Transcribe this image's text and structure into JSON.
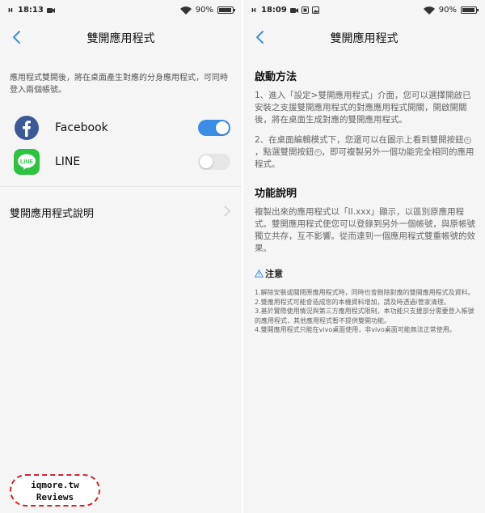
{
  "left": {
    "status": {
      "signal": "H",
      "time": "18:13",
      "battery": "90%"
    },
    "title": "雙開應用程式",
    "description": "應用程式雙開後，將在桌面產生對應的分身應用程式，可同時登入兩個帳號。",
    "apps": [
      {
        "name": "Facebook",
        "enabled": true,
        "icon": "facebook-icon",
        "color": "#3b5998"
      },
      {
        "name": "LINE",
        "enabled": false,
        "icon": "line-icon",
        "color": "#2bc33f"
      }
    ],
    "help_label": "雙開應用程式說明"
  },
  "right": {
    "status": {
      "signal": "H",
      "time": "18:09",
      "battery": "90%"
    },
    "title": "雙開應用程式",
    "section1_title": "啟動方法",
    "step1": "1、進入「設定>雙開應用程式」介面，您可以選擇開啟已安裝之支援雙開應用程式的對應應用程式開關，開啟開關後，將在桌面生成對應的雙開應用程式。",
    "step2a": "2、在桌面編輯模式下，您還可以在圖示上看到雙開按鈕",
    "step2b": "，點選雙開按鈕",
    "step2c": "，即可複製另外一個功能完全相同的應用程式。",
    "section2_title": "功能說明",
    "feature": "複製出來的應用程式以「II.xxx」顯示，以區別原應用程式。雙開應用程式使您可以登錄到另外一個帳號，與原帳號獨立共存，互不影響。從而達到一個應用程式雙重帳號的效果。",
    "warning_title": "注意",
    "notes": [
      "1.解除安裝或關閉原應用程式時，同時也會刪除對應的雙開應用程式及資料。",
      "2.雙應用程式可能會造成您的本機資料增加，請及時透過i管家清理。",
      "3.基於實際使用情況與第三方應用程式限制，本功能只支援部分需要登入帳號的應用程式，其他應用程式暫不提供雙開功能。",
      "4.雙開應用程式只能在vivo桌面使用，非vivo桌面可能無法正常使用。"
    ]
  },
  "watermark": {
    "line1": "iqmore.tw",
    "line2": "Reviews"
  },
  "colors": {
    "accent": "#3a8ee6",
    "facebook": "#3b5998",
    "line": "#2bc33f",
    "watermark_border": "#d8202a"
  }
}
